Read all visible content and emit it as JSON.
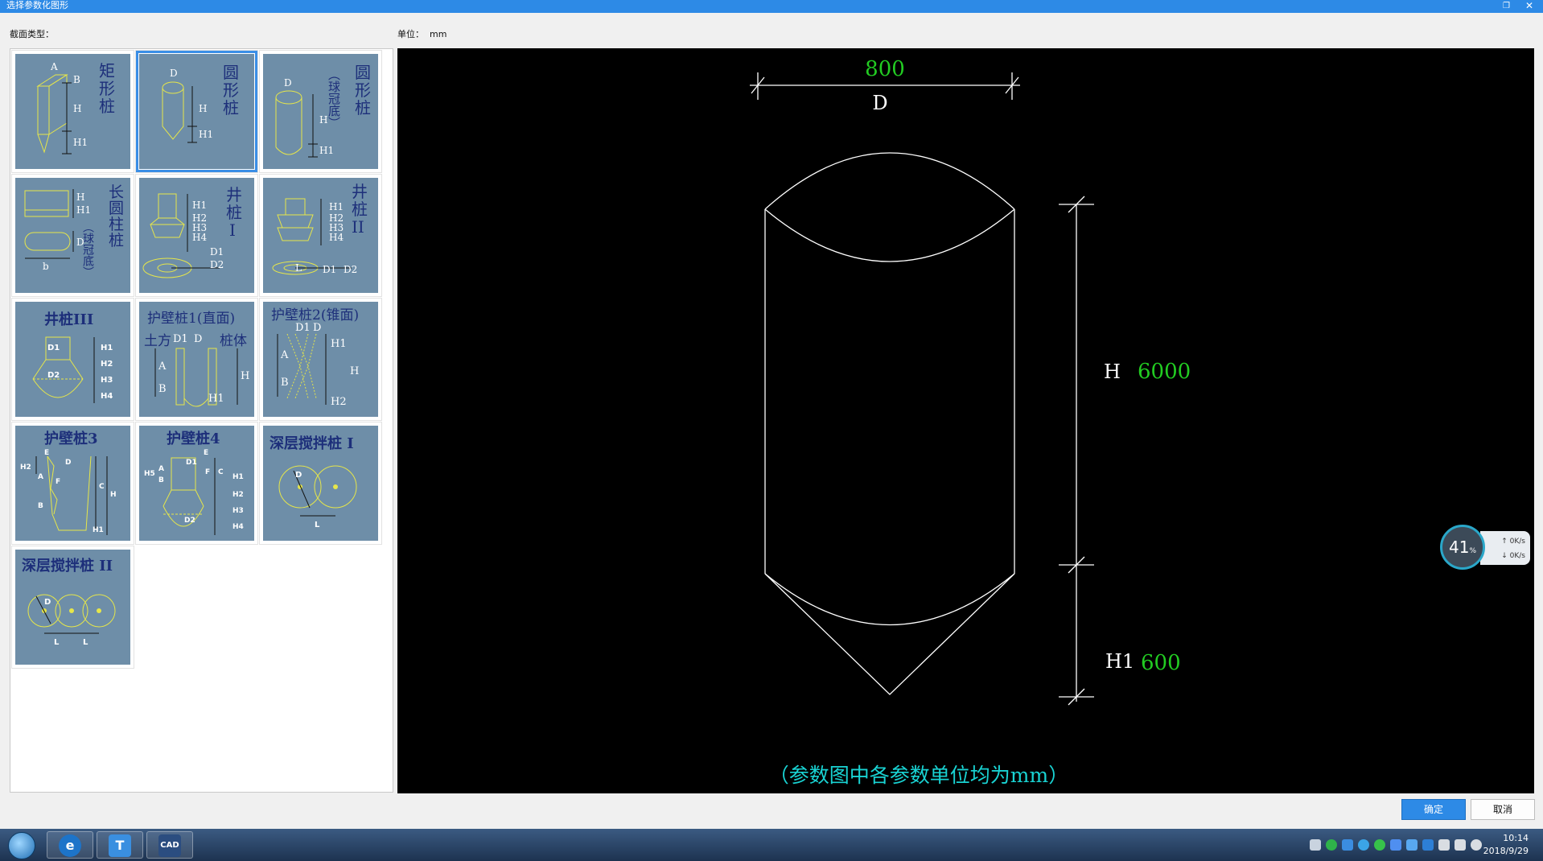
{
  "window": {
    "title": "选择参数化图形"
  },
  "labels": {
    "section_type": "截面类型：",
    "unit_label": "单位：",
    "unit_value": "mm"
  },
  "gallery": {
    "items": [
      {
        "id": "rect-pile",
        "title": "矩形桩",
        "selected": false
      },
      {
        "id": "round-pile",
        "title": "圆形桩",
        "selected": true
      },
      {
        "id": "round-pile-spherical",
        "title": "圆形桩（球冠底）",
        "selected": false
      },
      {
        "id": "long-round-pile",
        "title": "长圆柱桩（球冠底）",
        "selected": false
      },
      {
        "id": "well-pile-1",
        "title": "井桩I",
        "selected": false
      },
      {
        "id": "well-pile-2",
        "title": "井桩II",
        "selected": false
      },
      {
        "id": "well-pile-3",
        "title": "井桩III",
        "selected": false
      },
      {
        "id": "retaining-pile-1",
        "title": "护壁桩1(直面)",
        "selected": false
      },
      {
        "id": "retaining-pile-2",
        "title": "护壁桩2(锥面)",
        "selected": false
      },
      {
        "id": "retaining-pile-3",
        "title": "护壁桩3",
        "selected": false
      },
      {
        "id": "retaining-pile-4",
        "title": "护壁桩4",
        "selected": false
      },
      {
        "id": "deep-mix-pile-1",
        "title": "深层搅拌桩 I",
        "selected": false
      },
      {
        "id": "deep-mix-pile-2",
        "title": "深层搅拌桩 II",
        "selected": false
      }
    ],
    "thumb_labels": {
      "rect": [
        "矩",
        "形",
        "桩",
        "A",
        "B",
        "H",
        "H1"
      ],
      "round": [
        "圆",
        "形",
        "桩",
        "D",
        "H",
        "H1"
      ],
      "round_sph": [
        "圆",
        "形",
        "桩",
        "（球冠底）",
        "D",
        "H",
        "H1"
      ],
      "long_round": [
        "长",
        "圆",
        "柱",
        "桩",
        "（球冠底）",
        "H",
        "H1",
        "D",
        "b"
      ],
      "well1": [
        "井",
        "桩",
        "I",
        "H1",
        "H2",
        "H3",
        "H4",
        "D1",
        "D2"
      ],
      "well2": [
        "井",
        "桩",
        "II",
        "H1",
        "H2",
        "H3",
        "H4",
        "L",
        "D1",
        "D2"
      ],
      "well3": [
        "井桩III",
        "D1",
        "D2",
        "H1",
        "H2",
        "H3",
        "H4"
      ],
      "ret1": [
        "护壁桩1(直面)",
        "土方",
        "D1",
        "D",
        "桩体",
        "A",
        "B",
        "H",
        "H1"
      ],
      "ret2": [
        "护壁桩2(锥面)",
        "D1",
        "D",
        "A",
        "B",
        "H1",
        "H",
        "H2"
      ],
      "ret3": [
        "护壁桩3",
        "E",
        "D",
        "H2",
        "A",
        "F",
        "C",
        "H",
        "B",
        "H1"
      ],
      "ret4": [
        "护壁桩4",
        "E",
        "D1",
        "H5",
        "A",
        "B",
        "F",
        "C",
        "H1",
        "H2",
        "H3",
        "H4",
        "D2"
      ],
      "mix1": [
        "深层搅拌桩 I",
        "D",
        "L"
      ],
      "mix2": [
        "深层搅拌桩 II",
        "D",
        "L",
        "L"
      ]
    }
  },
  "preview": {
    "dim_D_value": "800",
    "dim_D_label": "D",
    "dim_H_label": "H",
    "dim_H_value": "6000",
    "dim_H1_label": "H1",
    "dim_H1_value": "600",
    "note": "（参数图中各参数单位均为mm）"
  },
  "netmon": {
    "percent": "41",
    "percent_unit": "%",
    "up": "0K/s",
    "down": "0K/s"
  },
  "buttons": {
    "ok": "确定",
    "cancel": "取消"
  },
  "taskbar": {
    "apps": [
      {
        "name": "IE",
        "glyph": "e"
      },
      {
        "name": "T20",
        "glyph": "T"
      },
      {
        "name": "CAD",
        "glyph": "CAD"
      }
    ],
    "time": "10:14",
    "date": "2018/9/29"
  },
  "colors": {
    "accent": "#2d8ae6",
    "thumb_bg": "#6e8ea8",
    "dim_value": "#22cc22",
    "note": "#19d3d3",
    "thumb_text": "#1d2f7a",
    "thumb_line": "#e6e64a"
  }
}
